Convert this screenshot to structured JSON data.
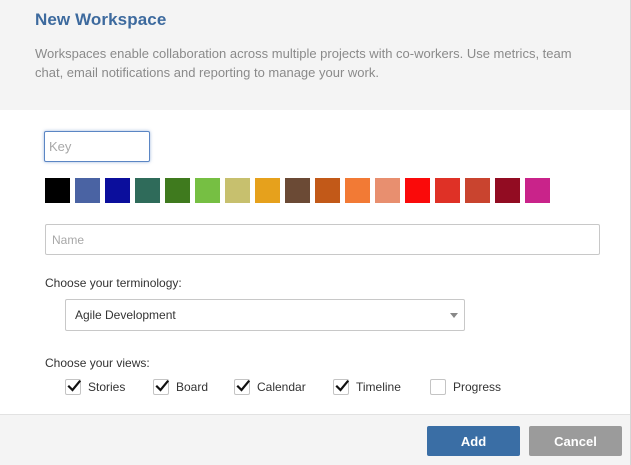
{
  "header": {
    "title": "New Workspace",
    "description": "Workspaces enable collaboration across multiple projects with co-workers. Use metrics, team chat, email notifications and reporting to manage your work."
  },
  "form": {
    "key": {
      "value": "",
      "placeholder": "Key"
    },
    "name": {
      "value": "",
      "placeholder": "Name"
    },
    "colors": [
      "#000000",
      "#4a63a3",
      "#0b0e9c",
      "#2f6b5a",
      "#3f7a1e",
      "#76bf43",
      "#c7c06e",
      "#e6a11c",
      "#6b4a35",
      "#c25918",
      "#f27a35",
      "#e88f6f",
      "#fa0a0a",
      "#df3126",
      "#c9442f",
      "#920c22",
      "#c9238a"
    ],
    "terminology": {
      "label": "Choose your terminology:",
      "selected": "Agile Development"
    },
    "views": {
      "label": "Choose your views:",
      "items": [
        {
          "label": "Stories",
          "checked": true
        },
        {
          "label": "Board",
          "checked": true
        },
        {
          "label": "Calendar",
          "checked": true
        },
        {
          "label": "Timeline",
          "checked": true
        },
        {
          "label": "Progress",
          "checked": false
        }
      ]
    }
  },
  "footer": {
    "add_label": "Add",
    "cancel_label": "Cancel"
  }
}
